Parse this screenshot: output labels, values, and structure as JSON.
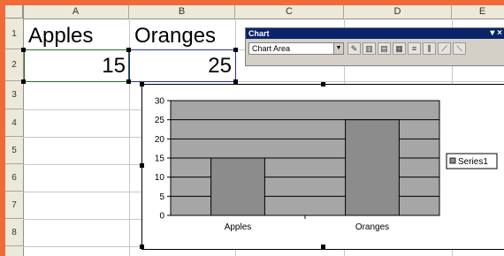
{
  "sheet": {
    "columns": [
      "A",
      "B",
      "C",
      "D",
      "E"
    ],
    "rows": [
      "1",
      "2",
      "3",
      "4",
      "5",
      "6",
      "7",
      "8"
    ],
    "cells": {
      "A1": "Apples",
      "B1": "Oranges",
      "A2": "15",
      "B2": "25"
    }
  },
  "chart_toolbar": {
    "title": "Chart",
    "selected_element": "Chart Area",
    "close_glyph": "▾ ×"
  },
  "chart_data": {
    "type": "bar",
    "categories": [
      "Apples",
      "Oranges"
    ],
    "series": [
      {
        "name": "Series1",
        "values": [
          15,
          25
        ]
      }
    ],
    "ylim": [
      0,
      30
    ],
    "yticks": [
      0,
      5,
      10,
      15,
      20,
      25,
      30
    ],
    "grid": true,
    "legend": "right",
    "colors": {
      "plot_area": "#a6a6a6",
      "bar": "#8c8c8c",
      "gridline": "#000000"
    }
  }
}
